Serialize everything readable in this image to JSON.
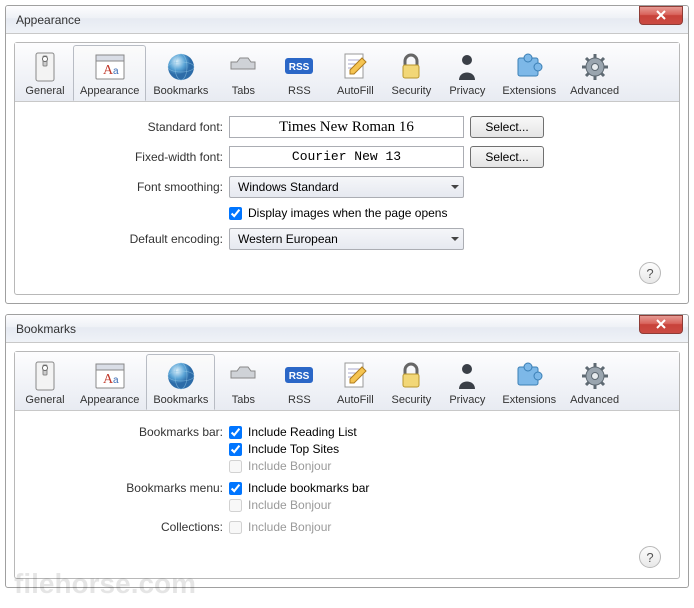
{
  "tabs": {
    "general": "General",
    "appearance": "Appearance",
    "bookmarks": "Bookmarks",
    "tabs": "Tabs",
    "rss": "RSS",
    "autofill": "AutoFill",
    "security": "Security",
    "privacy": "Privacy",
    "extensions": "Extensions",
    "advanced": "Advanced"
  },
  "appearance": {
    "title": "Appearance",
    "labels": {
      "standard_font": "Standard font:",
      "fixed_font": "Fixed-width font:",
      "smoothing": "Font smoothing:",
      "display_images": "Display images when the page opens",
      "encoding": "Default encoding:"
    },
    "values": {
      "standard_font": "Times New Roman 16",
      "fixed_font": "Courier New 13",
      "smoothing": "Windows Standard",
      "encoding": "Western European"
    },
    "select_btn": "Select...",
    "display_images_checked": true
  },
  "bookmarks": {
    "title": "Bookmarks",
    "labels": {
      "bar": "Bookmarks bar:",
      "menu": "Bookmarks menu:",
      "collections": "Collections:"
    },
    "options": {
      "include_reading": "Include Reading List",
      "include_top": "Include Top Sites",
      "include_bonjour": "Include Bonjour",
      "include_bookmarks_bar": "Include bookmarks bar"
    }
  },
  "watermark": "filehorse.com",
  "help": "?"
}
